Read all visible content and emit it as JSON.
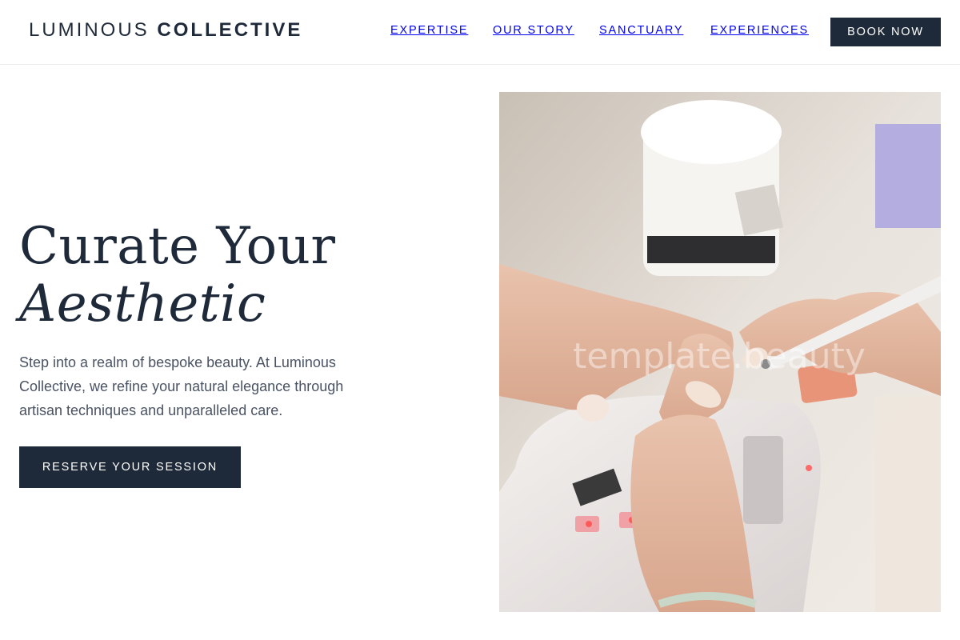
{
  "header": {
    "logo_light": "LUMINOUS",
    "logo_bold": "COLLECTIVE",
    "nav": [
      "EXPERTISE",
      "OUR STORY",
      "SANCTUARY",
      "EXPERIENCES"
    ],
    "book_label": "BOOK NOW"
  },
  "hero": {
    "title_line1": "Curate Your",
    "title_line2": "Aesthetic",
    "description": "Step into a realm of bespoke beauty. At Luminous Collective, we refine your natural elegance through artisan techniques and unparalleled care.",
    "cta_label": "RESERVE YOUR SESSION",
    "image_watermark": "template.beauty"
  },
  "colors": {
    "primary": "#1e2939",
    "text_muted": "#4a5363",
    "background": "#ffffff"
  }
}
